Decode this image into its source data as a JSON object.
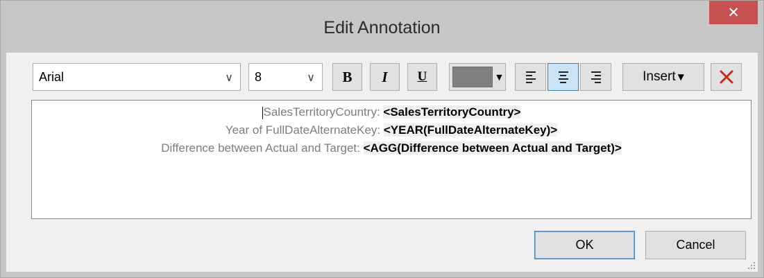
{
  "window": {
    "title": "Edit Annotation",
    "close_glyph": "✕"
  },
  "toolbar": {
    "font_family": "Arial",
    "font_size": "8",
    "dropdown_glyph": "∨",
    "bold_label": "B",
    "italic_label": "I",
    "underline_label": "U",
    "font_color": "#808080",
    "align_left_icon": "align-left-icon",
    "align_center_icon": "align-center-icon",
    "align_right_icon": "align-right-icon",
    "active_alignment": "center",
    "insert_label": "Insert",
    "insert_arrow": "▼",
    "clear_icon": "clear-x-icon",
    "clear_color": "#c42b1c"
  },
  "editor": {
    "lines": [
      {
        "label": "SalesTerritoryCountry: ",
        "field": "<SalesTerritoryCountry>"
      },
      {
        "label": "Year of FullDateAlternateKey: ",
        "field": "<YEAR(FullDateAlternateKey)>"
      },
      {
        "label": "Difference between Actual and Target: ",
        "field": "<AGG(Difference between Actual and Target)>"
      }
    ]
  },
  "buttons": {
    "ok_label": "OK",
    "cancel_label": "Cancel"
  }
}
